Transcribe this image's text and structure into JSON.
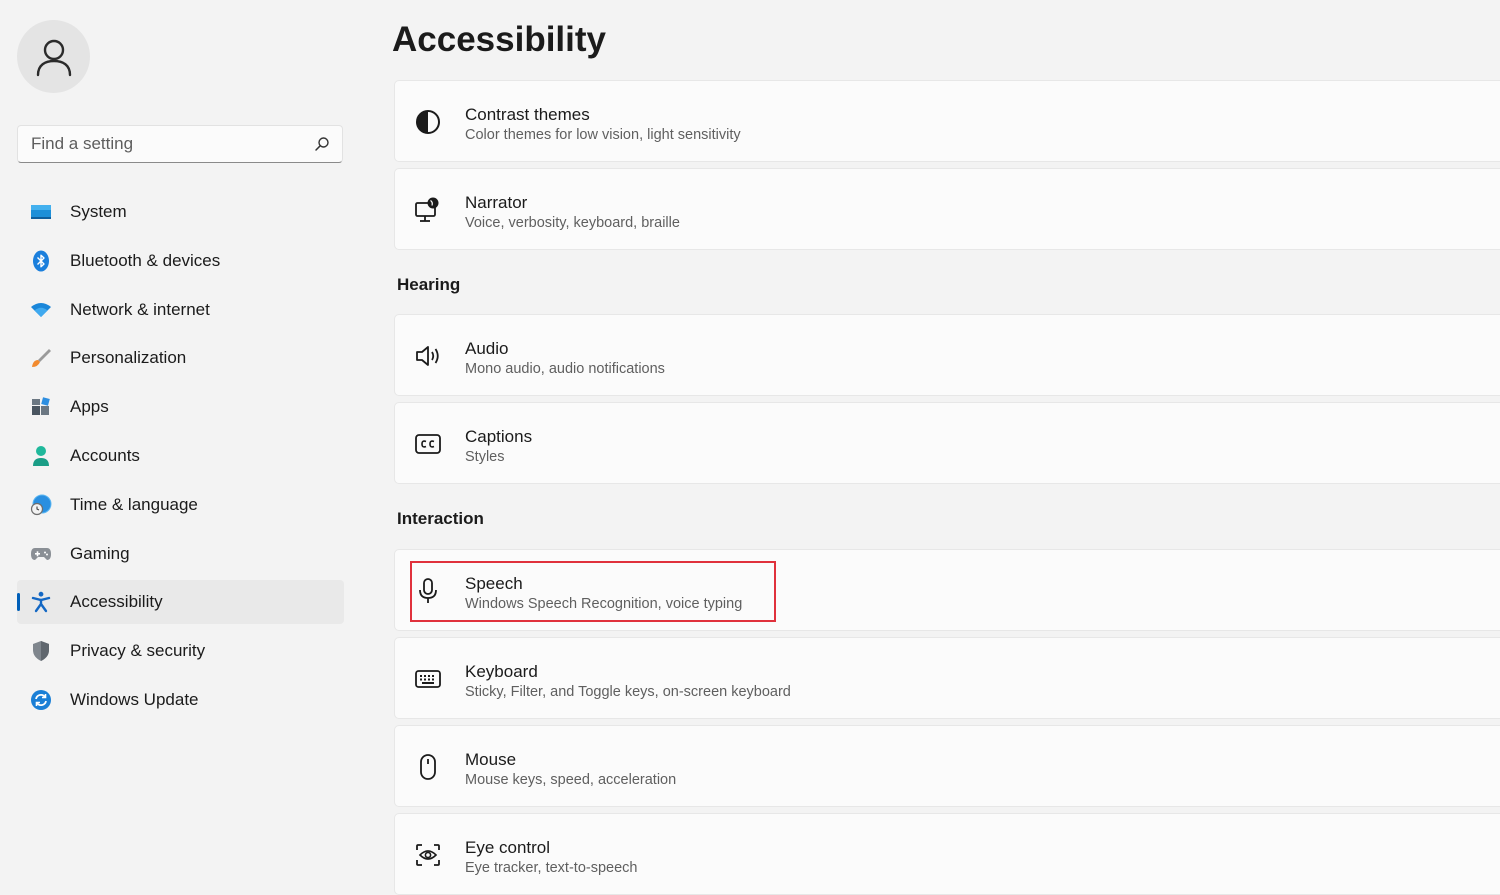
{
  "search": {
    "placeholder": "Find a setting"
  },
  "sidebar": {
    "items": [
      {
        "label": "System",
        "icon": "monitor-icon"
      },
      {
        "label": "Bluetooth & devices",
        "icon": "bluetooth-icon"
      },
      {
        "label": "Network & internet",
        "icon": "wifi-icon"
      },
      {
        "label": "Personalization",
        "icon": "brush-icon"
      },
      {
        "label": "Apps",
        "icon": "apps-icon"
      },
      {
        "label": "Accounts",
        "icon": "person-icon"
      },
      {
        "label": "Time & language",
        "icon": "globe-clock-icon"
      },
      {
        "label": "Gaming",
        "icon": "gamepad-icon"
      },
      {
        "label": "Accessibility",
        "icon": "accessibility-icon",
        "active": true
      },
      {
        "label": "Privacy & security",
        "icon": "shield-icon"
      },
      {
        "label": "Windows Update",
        "icon": "update-icon"
      }
    ]
  },
  "main": {
    "title": "Accessibility",
    "cards": [
      {
        "title": "Contrast themes",
        "subtitle": "Color themes for low vision, light sensitivity",
        "icon": "contrast-icon"
      },
      {
        "title": "Narrator",
        "subtitle": "Voice, verbosity, keyboard, braille",
        "icon": "narrator-icon"
      },
      {
        "title": "Audio",
        "subtitle": "Mono audio, audio notifications",
        "icon": "speaker-icon"
      },
      {
        "title": "Captions",
        "subtitle": "Styles",
        "icon": "captions-icon"
      },
      {
        "title": "Speech",
        "subtitle": "Windows Speech Recognition, voice typing",
        "icon": "microphone-icon",
        "highlighted": true
      },
      {
        "title": "Keyboard",
        "subtitle": "Sticky, Filter, and Toggle keys, on-screen keyboard",
        "icon": "keyboard-icon"
      },
      {
        "title": "Mouse",
        "subtitle": "Mouse keys, speed, acceleration",
        "icon": "mouse-icon"
      },
      {
        "title": "Eye control",
        "subtitle": "Eye tracker, text-to-speech",
        "icon": "eye-control-icon"
      }
    ],
    "sections": {
      "hearing": "Hearing",
      "interaction": "Interaction"
    }
  },
  "colors": {
    "accent": "#005fb8",
    "highlight_border": "#e0313c",
    "background": "#f3f3f3",
    "card": "#fbfbfb"
  }
}
